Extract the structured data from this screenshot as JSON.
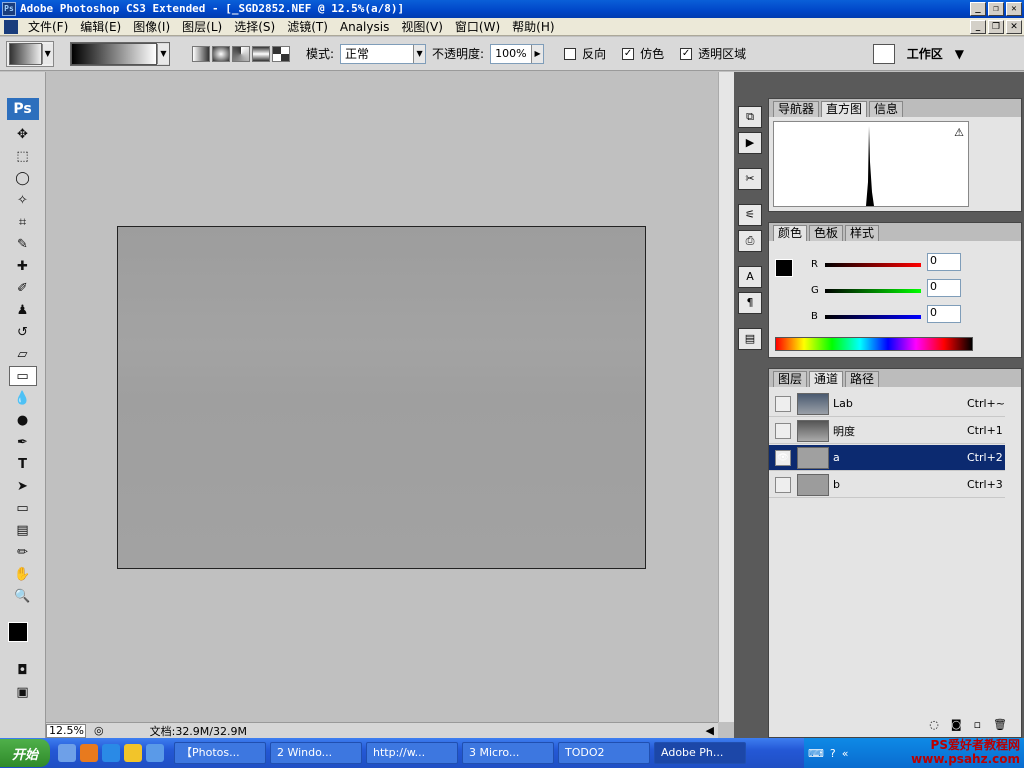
{
  "window": {
    "title": "Adobe Photoshop CS3 Extended - [_SGD2852.NEF @ 12.5%(a/8)]",
    "app_icon": "Ps"
  },
  "menu": [
    "文件(F)",
    "编辑(E)",
    "图像(I)",
    "图层(L)",
    "选择(S)",
    "滤镜(T)",
    "Analysis",
    "视图(V)",
    "窗口(W)",
    "帮助(H)"
  ],
  "options": {
    "mode_label": "模式:",
    "mode_value": "正常",
    "opacity_label": "不透明度:",
    "opacity_value": "100%",
    "reverse_label": "反向",
    "reverse_checked": false,
    "dither_label": "仿色",
    "dither_checked": true,
    "transparency_label": "透明区域",
    "transparency_checked": true,
    "workspace_label": "工作区"
  },
  "toolbox": {
    "logo": "Ps",
    "tools": [
      "move-tool-icon",
      "marquee-tool-icon",
      "lasso-tool-icon",
      "magic-wand-icon",
      "crop-tool-icon",
      "slice-tool-icon",
      "healing-brush-icon",
      "brush-tool-icon",
      "stamp-tool-icon",
      "history-brush-icon",
      "eraser-icon",
      "gradient-tool-icon",
      "blur-tool-icon",
      "dodge-tool-icon",
      "pen-tool-icon",
      "type-tool-icon",
      "path-select-icon",
      "shape-tool-icon",
      "notes-icon",
      "eyedropper-icon",
      "hand-tool-icon",
      "zoom-tool-icon"
    ]
  },
  "status": {
    "zoom": "12.5%",
    "doc_info": "文档:32.9M/32.9M"
  },
  "panels": {
    "histogram": {
      "tabs": [
        "导航器",
        "直方图",
        "信息"
      ],
      "active": 1
    },
    "color": {
      "tabs": [
        "颜色",
        "色板",
        "样式"
      ],
      "active": 0,
      "r_label": "R",
      "g_label": "G",
      "b_label": "B",
      "r": "0",
      "g": "0",
      "b": "0"
    },
    "channels": {
      "tabs": [
        "图层",
        "通道",
        "路径"
      ],
      "active": 1,
      "rows": [
        {
          "name": "Lab",
          "shortcut": "Ctrl+~",
          "visible": false,
          "selected": false
        },
        {
          "name": "明度",
          "shortcut": "Ctrl+1",
          "visible": false,
          "selected": false
        },
        {
          "name": "a",
          "shortcut": "Ctrl+2",
          "visible": true,
          "selected": true
        },
        {
          "name": "b",
          "shortcut": "Ctrl+3",
          "visible": false,
          "selected": false
        }
      ]
    }
  },
  "taskbar": {
    "start": "开始",
    "buttons": [
      "【Photos...",
      "2 Windo...",
      "http://w...",
      "3 Micro...",
      "TODO2",
      "Adobe Ph..."
    ],
    "watermark": "PS爱好者教程网",
    "watermark_url": "www.psahz.com"
  }
}
